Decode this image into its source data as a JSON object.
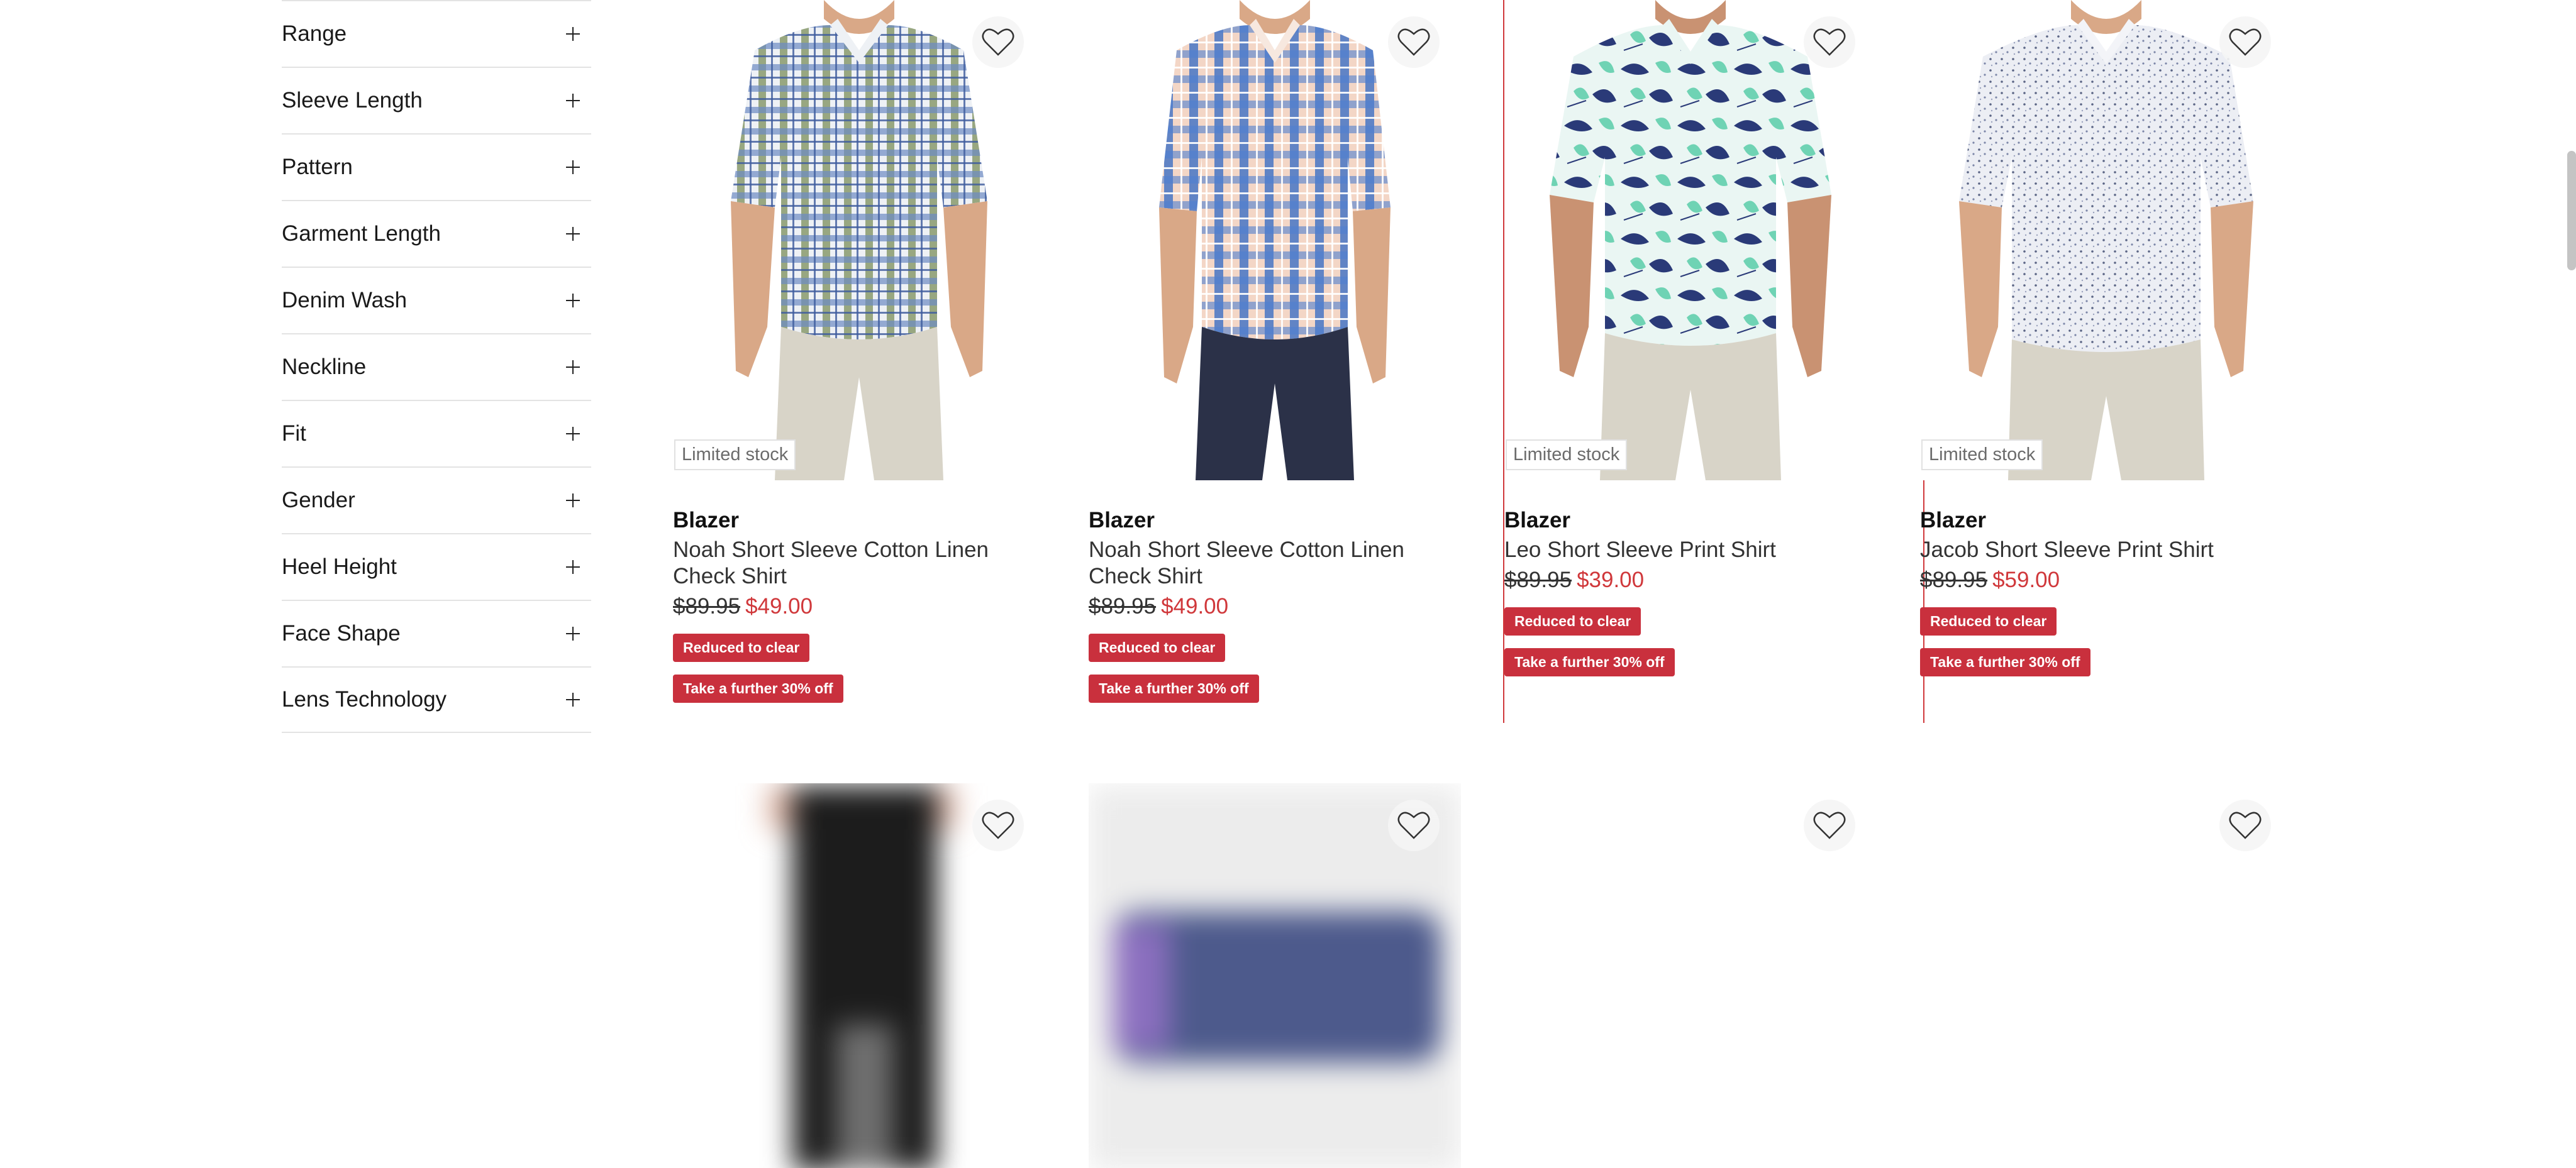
{
  "filters": [
    {
      "label": "Range"
    },
    {
      "label": "Sleeve Length"
    },
    {
      "label": "Pattern"
    },
    {
      "label": "Garment Length"
    },
    {
      "label": "Denim Wash"
    },
    {
      "label": "Neckline"
    },
    {
      "label": "Fit"
    },
    {
      "label": "Gender"
    },
    {
      "label": "Heel Height"
    },
    {
      "label": "Face Shape"
    },
    {
      "label": "Lens Technology"
    }
  ],
  "products": [
    {
      "badge": "Limited stock",
      "brand": "Blazer",
      "name": "Noah Short Sleeve Cotton Linen Check Shirt",
      "was_price": "$89.95",
      "now_price": "$49.00",
      "promo_1": "Reduced to clear",
      "promo_2": "Take a further 30% off",
      "shirt_pattern": "green-blue-check",
      "pants_color": "#d8d4c8"
    },
    {
      "badge": "",
      "brand": "Blazer",
      "name": "Noah Short Sleeve Cotton Linen Check Shirt",
      "was_price": "$89.95",
      "now_price": "$49.00",
      "promo_1": "Reduced to clear",
      "promo_2": "Take a further 30% off",
      "shirt_pattern": "peach-blue-check",
      "pants_color": "#2b3148"
    },
    {
      "badge": "Limited stock",
      "brand": "Blazer",
      "name": "Leo Short Sleeve Print Shirt",
      "was_price": "$89.95",
      "now_price": "$39.00",
      "promo_1": "Reduced to clear",
      "promo_2": "Take a further 30% off",
      "shirt_pattern": "tropical-print",
      "pants_color": "#d8d4c8"
    },
    {
      "badge": "Limited stock",
      "brand": "Blazer",
      "name": "Jacob Short Sleeve Print Shirt",
      "was_price": "$89.95",
      "now_price": "$59.00",
      "promo_1": "Reduced to clear",
      "promo_2": "Take a further 30% off",
      "shirt_pattern": "white-micro-print",
      "pants_color": "#d8d4c8"
    }
  ],
  "icons": {
    "wishlist": "heart-outline-icon",
    "expand": "plus-icon"
  },
  "colors": {
    "sale_red": "#d0383b",
    "promo_bg": "#c9303d",
    "divider": "#e3e3e3"
  }
}
